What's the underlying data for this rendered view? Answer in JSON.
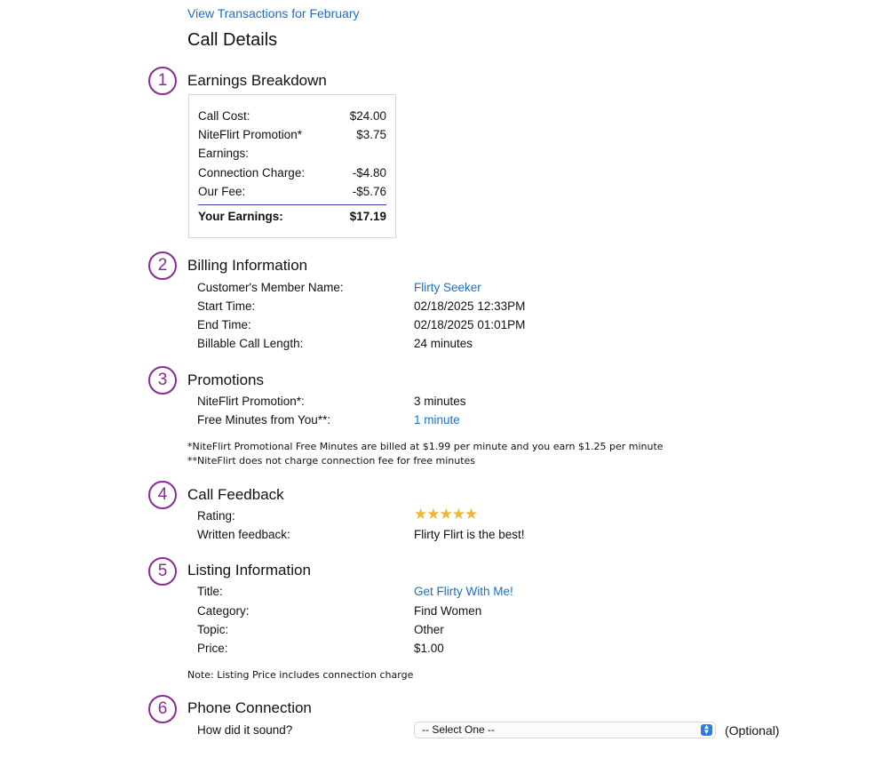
{
  "header": {
    "back_link": "View Transactions for February",
    "title": "Call Details"
  },
  "sections": {
    "earnings": {
      "number": "1",
      "title": "Earnings Breakdown",
      "rows": [
        {
          "label": "Call Cost:",
          "value": "$24.00"
        },
        {
          "label": "NiteFlirt Promotion*",
          "value": "$3.75"
        },
        {
          "label": "Earnings:",
          "value": ""
        },
        {
          "label": "Connection Charge:",
          "value": "-$4.80"
        },
        {
          "label": "Our Fee:",
          "value": "-$5.76"
        }
      ],
      "total": {
        "label": "Your Earnings:",
        "value": "$17.19"
      }
    },
    "billing": {
      "number": "2",
      "title": "Billing Information",
      "rows": [
        {
          "label": "Customer's Member Name:",
          "value": "Flirty Seeker"
        },
        {
          "label": "Start Time:",
          "value": "02/18/2025 12:33PM"
        },
        {
          "label": "End Time:",
          "value": "02/18/2025 01:01PM"
        },
        {
          "label": "Billable Call Length:",
          "value": "24 minutes"
        }
      ]
    },
    "promotions": {
      "number": "3",
      "title": "Promotions",
      "rows": [
        {
          "label": "NiteFlirt Promotion*:",
          "value": "3 minutes"
        },
        {
          "label": "Free Minutes from You**:",
          "value": "1 minute"
        }
      ],
      "notes": [
        "*NiteFlirt Promotional Free Minutes are billed at $1.99 per minute and you earn $1.25 per minute",
        "**NiteFlirt does not charge connection fee for free minutes"
      ]
    },
    "feedback": {
      "number": "4",
      "title": "Call Feedback",
      "rating_label": "Rating:",
      "rating_stars": "★★★★★",
      "rating_value": 5,
      "rating_max": 5,
      "star_color": "#f2b632",
      "written_label": "Written feedback:",
      "written_value": "Flirty Flirt is the best!"
    },
    "listing": {
      "number": "5",
      "title": "Listing Information",
      "rows": [
        {
          "label": "Title:",
          "value": "Get Flirty With Me!"
        },
        {
          "label": "Category:",
          "value": "Find Women"
        },
        {
          "label": "Topic:",
          "value": "Other"
        },
        {
          "label": "Price:",
          "value": "$1.00"
        }
      ],
      "note": "Note: Listing Price includes connection charge"
    },
    "phone": {
      "number": "6",
      "title": "Phone Connection",
      "question": "How did it sound?",
      "select_value": "-- Select One --",
      "optional": "(Optional)"
    }
  },
  "colors": {
    "link": "#1a6fc9",
    "badge": "#8a2a97",
    "total_rule": "#3b3fa0"
  }
}
